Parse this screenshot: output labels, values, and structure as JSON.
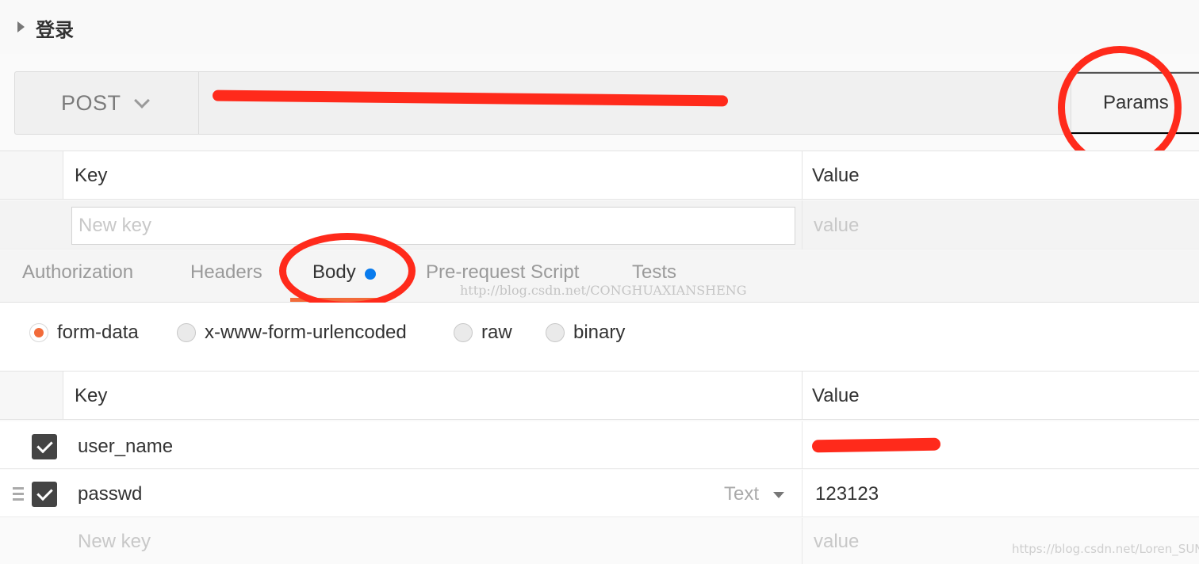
{
  "request": {
    "title": "登录",
    "method": "POST",
    "url": "",
    "params_label": "Params"
  },
  "params_table": {
    "key_header": "Key",
    "value_header": "Value",
    "new_key_placeholder": "New key",
    "value_placeholder": "value"
  },
  "tabs": [
    {
      "label": "Authorization",
      "active": false
    },
    {
      "label": "Headers",
      "active": false
    },
    {
      "label": "Body",
      "active": true
    },
    {
      "label": "Pre-request Script",
      "active": false
    },
    {
      "label": "Tests",
      "active": false
    }
  ],
  "watermarks": {
    "center": "http://blog.csdn.net/CONGHUAXIANSHENG",
    "corner": "https://blog.csdn.net/Loren_SUN"
  },
  "body_types": [
    {
      "label": "form-data",
      "selected": true
    },
    {
      "label": "x-www-form-urlencoded",
      "selected": false
    },
    {
      "label": "raw",
      "selected": false
    },
    {
      "label": "binary",
      "selected": false
    }
  ],
  "body_table": {
    "key_header": "Key",
    "value_header": "Value",
    "rows": [
      {
        "key": "user_name",
        "value": "",
        "checked": true
      },
      {
        "key": "passwd",
        "value": "123123",
        "checked": true,
        "type": "Text"
      }
    ],
    "new_key_placeholder": "New key",
    "value_placeholder": "value"
  },
  "colors": {
    "accent_orange": "#f26b3a",
    "annotation_red": "#ff2a1b",
    "modified_dot_blue": "#097bed"
  }
}
